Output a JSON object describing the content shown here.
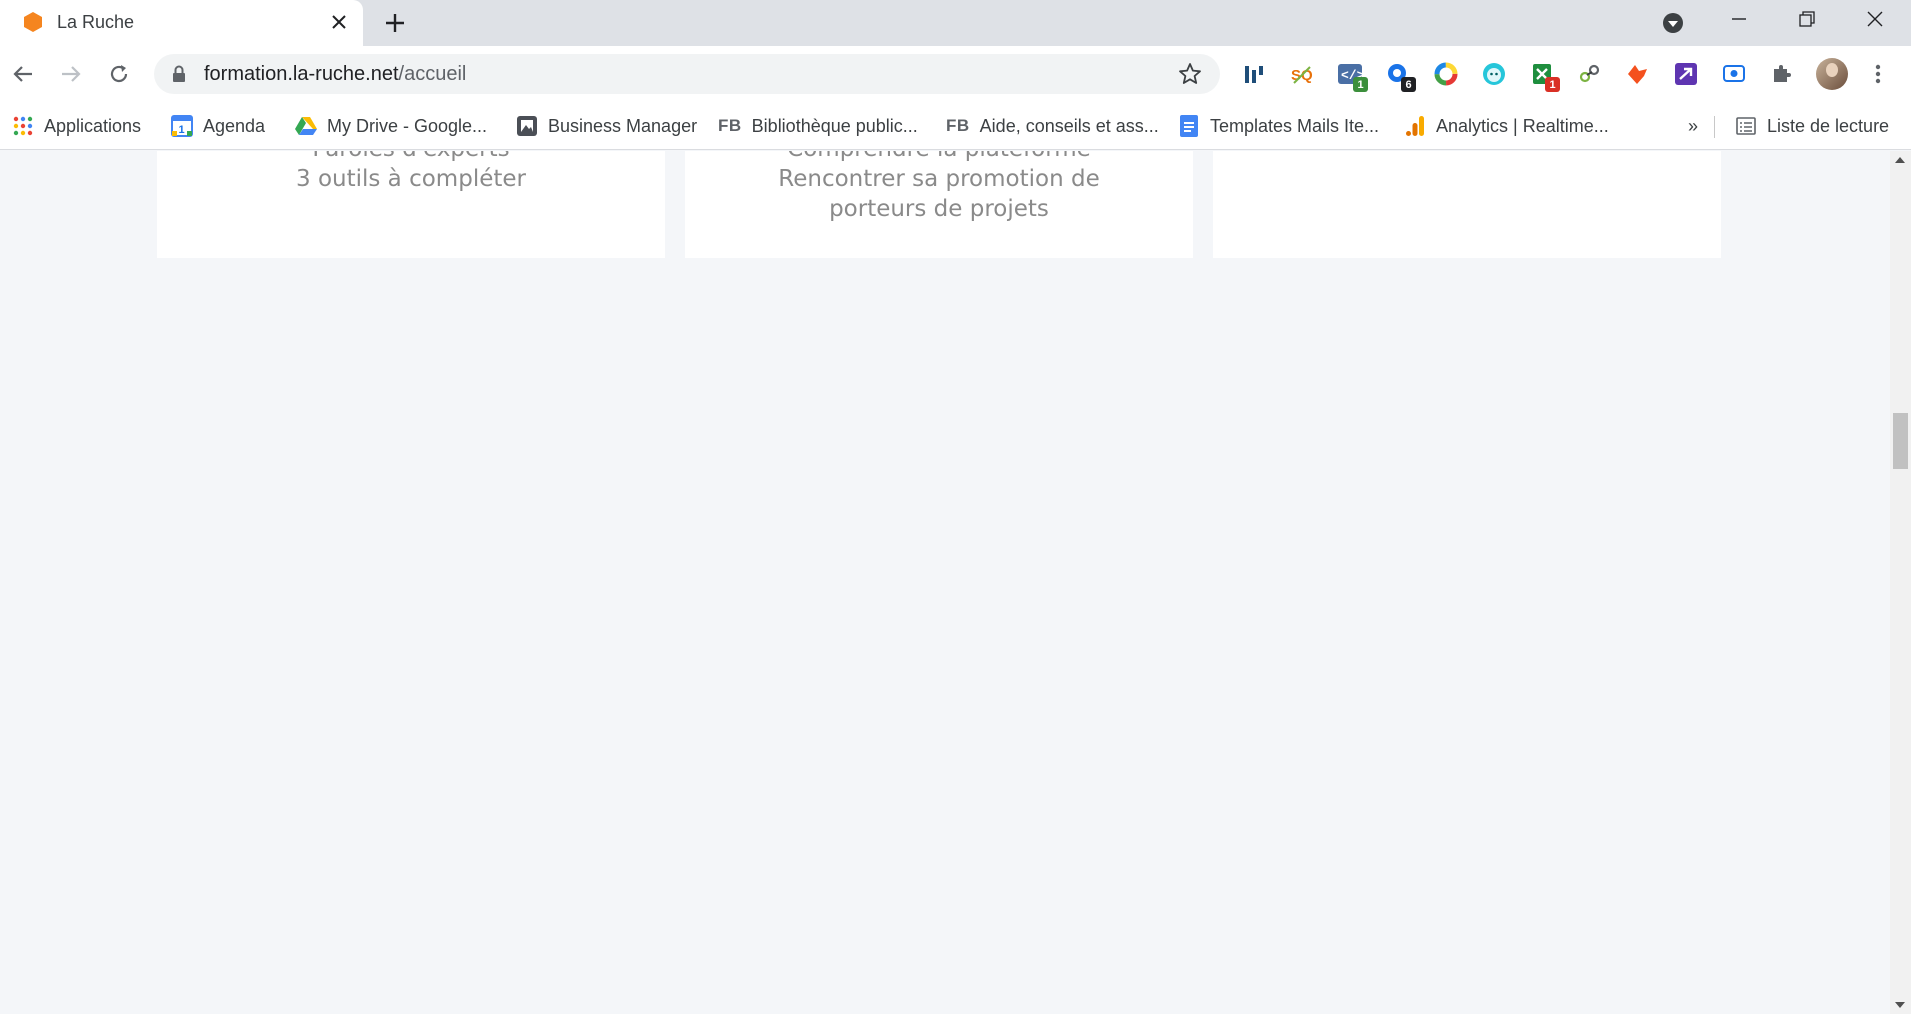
{
  "browser": {
    "tab": {
      "title": "La Ruche",
      "favicon": "hexagon-icon",
      "favicon_color": "#f5851f"
    },
    "address": {
      "host": "formation.la-ruche.net",
      "path": "/accueil"
    },
    "bookmarks": [
      {
        "label": "Applications",
        "icon": "apps-grid-icon"
      },
      {
        "label": "Agenda",
        "icon": "calendar-icon",
        "icon_text": "1"
      },
      {
        "label": "My Drive - Google...",
        "icon": "google-drive-icon"
      },
      {
        "label": "Business Manager",
        "icon": "business-manager-icon"
      },
      {
        "label": "Bibliothèque public...",
        "icon": "fb-icon",
        "icon_text": "FB"
      },
      {
        "label": "Aide, conseils et ass...",
        "icon": "fb-icon",
        "icon_text": "FB"
      },
      {
        "label": "Templates Mails Ite...",
        "icon": "google-docs-icon"
      },
      {
        "label": "Analytics | Realtime...",
        "icon": "analytics-icon"
      }
    ],
    "bookmarks_overflow": "»",
    "reading_list": "Liste de lecture",
    "extension_badges": {
      "code": "1",
      "chat": "6",
      "sheet": "1"
    }
  },
  "cards": [
    {
      "lines": [
        "Paroles d'experts",
        "3 outils à compléter"
      ]
    },
    {
      "lines": [
        "Comprendre la plateforme",
        "Rencontrer sa promotion de",
        "porteurs de projets"
      ]
    },
    {
      "lines": []
    }
  ],
  "colors": {
    "accent_orange": "#f5851f",
    "page_bg": "#f4f6f9",
    "card_text": "#8a8a8a"
  }
}
